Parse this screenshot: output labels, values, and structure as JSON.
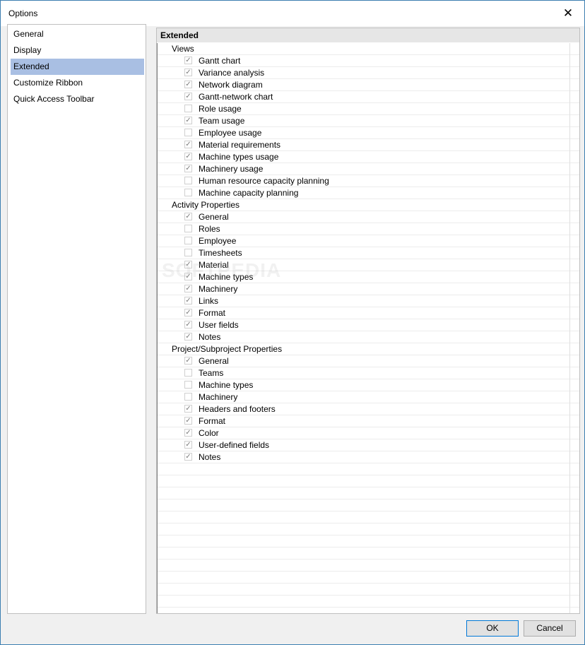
{
  "window": {
    "title": "Options",
    "close_glyph": "✕"
  },
  "nav": {
    "items": [
      {
        "label": "General",
        "selected": false
      },
      {
        "label": "Display",
        "selected": false
      },
      {
        "label": "Extended",
        "selected": true
      },
      {
        "label": "Customize Ribbon",
        "selected": false
      },
      {
        "label": "Quick Access Toolbar",
        "selected": false
      }
    ]
  },
  "panel": {
    "header": "Extended",
    "groups": [
      {
        "label": "Views",
        "items": [
          {
            "label": "Gantt chart",
            "checked": true
          },
          {
            "label": "Variance analysis",
            "checked": true
          },
          {
            "label": "Network diagram",
            "checked": true
          },
          {
            "label": "Gantt-network chart",
            "checked": true
          },
          {
            "label": "Role usage",
            "checked": false
          },
          {
            "label": "Team usage",
            "checked": true
          },
          {
            "label": "Employee usage",
            "checked": false
          },
          {
            "label": "Material requirements",
            "checked": true
          },
          {
            "label": "Machine types usage",
            "checked": true
          },
          {
            "label": "Machinery usage",
            "checked": true
          },
          {
            "label": "Human resource capacity planning",
            "checked": false
          },
          {
            "label": "Machine capacity planning",
            "checked": false
          }
        ]
      },
      {
        "label": "Activity Properties",
        "items": [
          {
            "label": "General",
            "checked": true
          },
          {
            "label": "Roles",
            "checked": false
          },
          {
            "label": "Employee",
            "checked": false
          },
          {
            "label": "Timesheets",
            "checked": false
          },
          {
            "label": "Material",
            "checked": true
          },
          {
            "label": "Machine types",
            "checked": true
          },
          {
            "label": "Machinery",
            "checked": true
          },
          {
            "label": "Links",
            "checked": true
          },
          {
            "label": "Format",
            "checked": true
          },
          {
            "label": "User fields",
            "checked": true
          },
          {
            "label": "Notes",
            "checked": true
          }
        ]
      },
      {
        "label": "Project/Subproject Properties",
        "items": [
          {
            "label": "General",
            "checked": true
          },
          {
            "label": "Teams",
            "checked": false
          },
          {
            "label": "Machine types",
            "checked": false
          },
          {
            "label": "Machinery",
            "checked": false
          },
          {
            "label": "Headers and footers",
            "checked": true
          },
          {
            "label": "Format",
            "checked": true
          },
          {
            "label": "Color",
            "checked": true
          },
          {
            "label": "User-defined fields",
            "checked": true
          },
          {
            "label": "Notes",
            "checked": true
          }
        ]
      }
    ]
  },
  "buttons": {
    "ok": "OK",
    "cancel": "Cancel"
  },
  "watermark": "SOFTPEDIA",
  "colors": {
    "selection": "#a9bfe3",
    "border": "#3c7fb1",
    "ok_border": "#0078d7"
  },
  "icons": {
    "checkmark": "✓"
  }
}
